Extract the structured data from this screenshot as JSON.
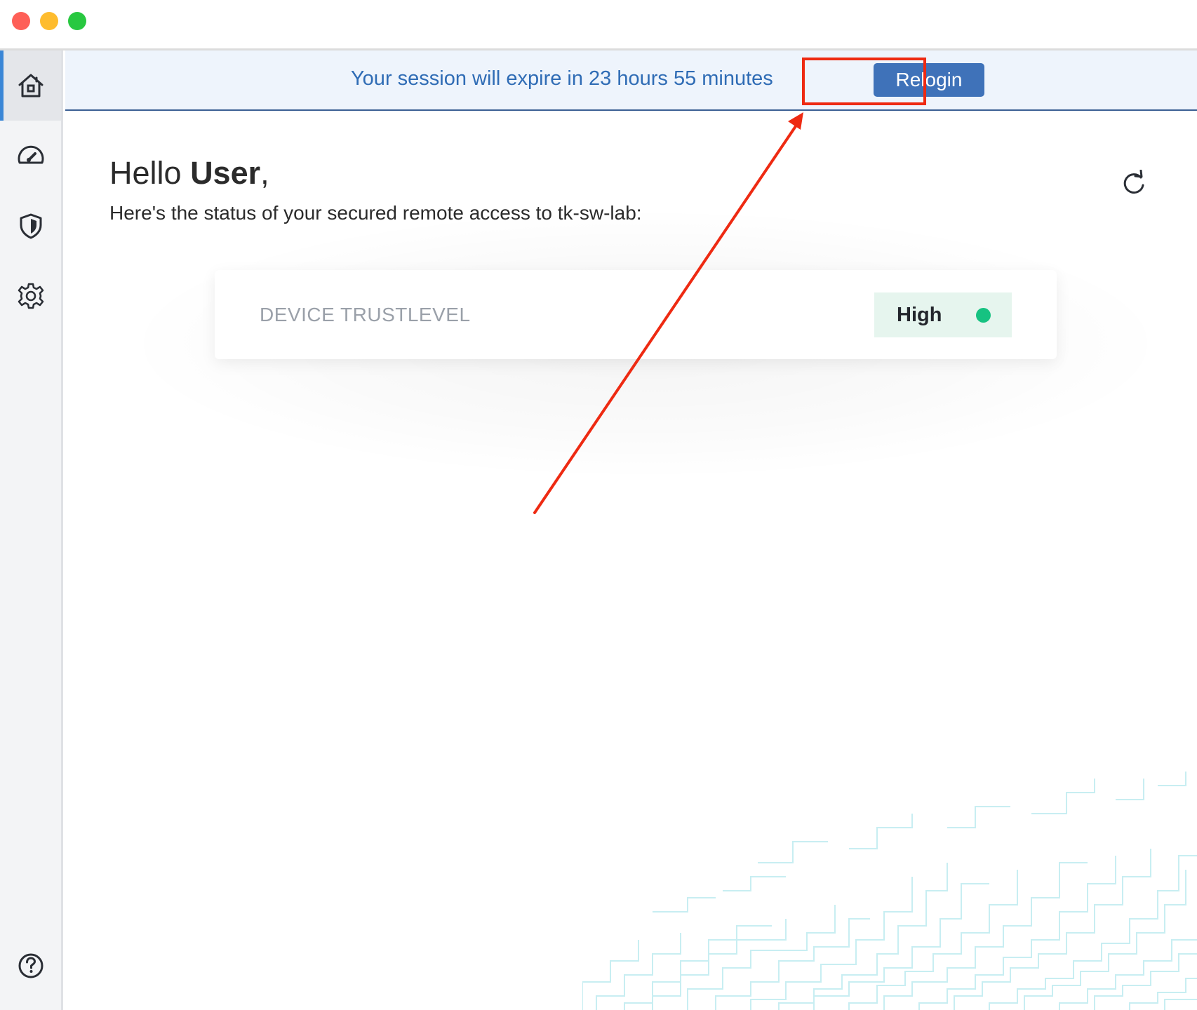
{
  "window": {
    "controls": [
      "close",
      "minimize",
      "maximize"
    ]
  },
  "sidebar": {
    "items": [
      {
        "id": "home",
        "icon": "home-icon",
        "active": true
      },
      {
        "id": "dashboard",
        "icon": "speedometer-icon",
        "active": false
      },
      {
        "id": "security",
        "icon": "shield-icon",
        "active": false
      },
      {
        "id": "settings",
        "icon": "gear-icon",
        "active": false
      }
    ],
    "help_icon": "help-icon"
  },
  "banner": {
    "message": "Your session will expire in 23 hours 55 minutes",
    "relogin_label": "Relogin"
  },
  "main": {
    "greeting_prefix": "Hello ",
    "user_name": "User",
    "greeting_suffix": ",",
    "status_text": "Here's the status of your secured remote access to tk-sw-lab:",
    "refresh_icon": "refresh-icon"
  },
  "trust_card": {
    "label": "DEVICE TRUSTLEVEL",
    "value": "High",
    "status_color": "#16c281"
  },
  "colors": {
    "accent": "#3f72b9",
    "banner_text": "#2f6cb5",
    "annotation": "#ee2a12"
  }
}
